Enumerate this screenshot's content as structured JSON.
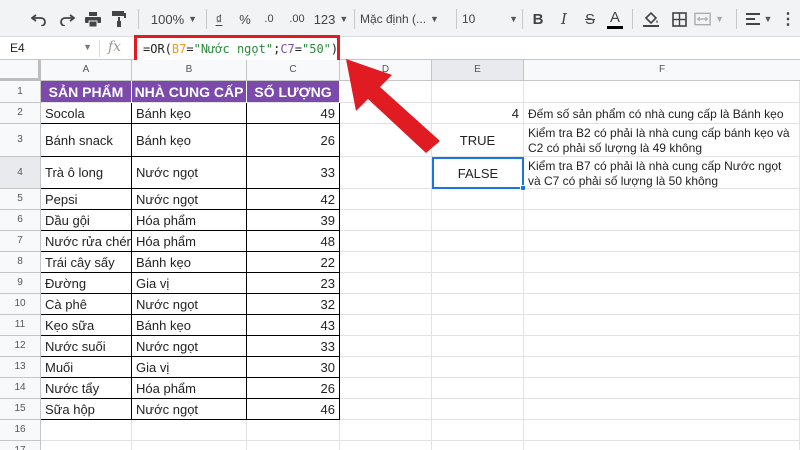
{
  "toolbar": {
    "zoom": "100%",
    "currency": "₫",
    "percent": "%",
    "decimal_less": ".0",
    "decimal_more": ".00",
    "number_format": "123",
    "font": "Mặc định (...",
    "font_size": "10",
    "bold": "B",
    "italic": "I",
    "strike": "S",
    "text_color": "A"
  },
  "formula_bar": {
    "name_box": "E4",
    "fx": "fx",
    "formula_parts": [
      "=OR(",
      "B7",
      "=\"Nước ngọt\";",
      "C7",
      "=\"50\")"
    ]
  },
  "columns": [
    "A",
    "B",
    "C",
    "D",
    "E",
    "F"
  ],
  "rows": [
    "1",
    "2",
    "3",
    "4",
    "5",
    "6",
    "7",
    "8",
    "9",
    "10",
    "11",
    "12",
    "13",
    "14",
    "15",
    "16",
    "17"
  ],
  "table": {
    "headers": [
      "SẢN PHẨM",
      "NHÀ CUNG CẤP",
      "SỐ LƯỢNG"
    ],
    "rows": [
      [
        "Socola",
        "Bánh kẹo",
        "49"
      ],
      [
        "Bánh snack",
        "Bánh kẹo",
        "26"
      ],
      [
        "Trà ô long",
        "Nước ngọt",
        "33"
      ],
      [
        "Pepsi",
        "Nước ngọt",
        "42"
      ],
      [
        "Dầu gội",
        "Hóa phẩm",
        "39"
      ],
      [
        "Nước rửa chén",
        "Hóa phẩm",
        "48"
      ],
      [
        "Trái cây sấy",
        "Bánh kẹo",
        "22"
      ],
      [
        "Đường",
        "Gia vị",
        "23"
      ],
      [
        "Cà phê",
        "Nước ngọt",
        "32"
      ],
      [
        "Kẹo sữa",
        "Bánh kẹo",
        "43"
      ],
      [
        "Nước suối",
        "Nước ngọt",
        "33"
      ],
      [
        "Muối",
        "Gia vị",
        "30"
      ],
      [
        "Nước tẩy",
        "Hóa phẩm",
        "26"
      ],
      [
        "Sữa hộp",
        "Nước ngọt",
        "46"
      ]
    ]
  },
  "results": {
    "e2": "4",
    "e3": "TRUE",
    "e4": "FALSE"
  },
  "notes": {
    "f2": "Đếm số sản phẩm có nhà cung cấp là Bánh kẹo",
    "f3": "Kiểm tra B2 có phải là nhà cung cấp bánh kẹo và C2 có phải số lượng là 49 không",
    "f4": "Kiểm tra B7 có phải là nhà cung cấp Nước ngọt và C7 có phải số lượng là 50 không"
  },
  "colors": {
    "header_fill": "#7b4aab",
    "highlight_border": "#e01b22",
    "arrow": "#e01b22",
    "selection": "#1a73e8"
  }
}
